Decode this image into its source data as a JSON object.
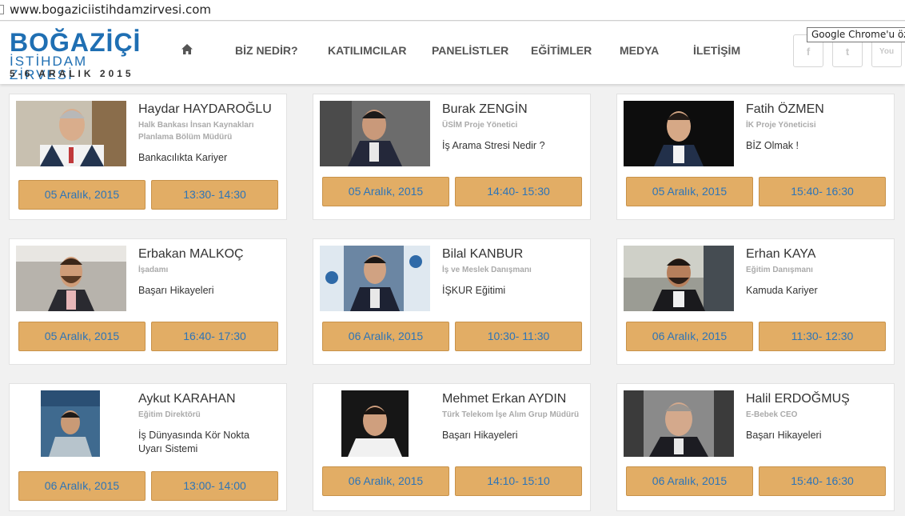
{
  "browser": {
    "url": "www.bogaziciistihdamzirvesi.com",
    "tooltip": "Google Chrome'u özel"
  },
  "logo": {
    "line1": "BOĞAZİÇİ",
    "line2": "İSTİHDAM ZİRVESİ",
    "line3": "5-6 ARALIK 2015"
  },
  "nav": {
    "home_icon": "home-icon",
    "items": [
      "BİZ NEDİR?",
      "KATILIMCILAR",
      "PANELİSTLER",
      "EĞİTİMLER",
      "MEDYA",
      "İLETİŞİM"
    ]
  },
  "social": [
    {
      "icon": "facebook-icon",
      "glyph": "f"
    },
    {
      "icon": "twitter-icon",
      "glyph": "t"
    },
    {
      "icon": "youtube-icon",
      "glyph": "You"
    }
  ],
  "colors": {
    "accent_button": "#e2ad65",
    "button_text": "#2c74b8",
    "brand_blue": "#1f6fb3"
  },
  "cards": [
    {
      "name": "Haydar HAYDAROĞLU",
      "role": "Halk Bankası İnsan Kaynakları Planlama Bölüm Müdürü",
      "topic": "Bankacılıkta Kariyer",
      "date": "05 Aralık, 2015",
      "time": "13:30- 14:30"
    },
    {
      "name": "Burak ZENGİN",
      "role": "ÜSİM Proje Yönetici",
      "topic": "İş Arama Stresi Nedir ?",
      "date": "05 Aralık, 2015",
      "time": "14:40- 15:30"
    },
    {
      "name": "Fatih ÖZMEN",
      "role": "İK Proje Yöneticisi",
      "topic": "BİZ Olmak !",
      "date": "05 Aralık, 2015",
      "time": "15:40- 16:30"
    },
    {
      "name": "Erbakan MALKOÇ",
      "role": "İşadamı",
      "topic": "Başarı Hikayeleri",
      "date": "05 Aralık, 2015",
      "time": "16:40- 17:30"
    },
    {
      "name": "Bilal KANBUR",
      "role": "İş ve Meslek Danışmanı",
      "topic": "İŞKUR Eğitimi",
      "date": "06 Aralık, 2015",
      "time": "10:30- 11:30"
    },
    {
      "name": "Erhan KAYA",
      "role": "Eğitim Danışmanı",
      "topic": "Kamuda Kariyer",
      "date": "06 Aralık, 2015",
      "time": "11:30- 12:30"
    },
    {
      "name": "Aykut KARAHAN",
      "role": "Eğitim Direktörü",
      "topic": "İş Dünyasında Kör Nokta Uyarı Sistemi",
      "date": "06 Aralık, 2015",
      "time": "13:00- 14:00"
    },
    {
      "name": "Mehmet Erkan AYDIN",
      "role": "Türk Telekom İşe Alım Grup Müdürü",
      "topic": "Başarı Hikayeleri",
      "date": "06 Aralık, 2015",
      "time": "14:10- 15:10"
    },
    {
      "name": "Halil ERDOĞMUŞ",
      "role": "E-Bebek CEO",
      "topic": "Başarı Hikayeleri",
      "date": "06 Aralık, 2015",
      "time": "15:40- 16:30"
    }
  ]
}
